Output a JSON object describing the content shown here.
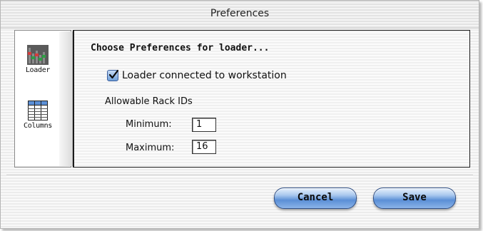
{
  "window": {
    "title": "Preferences"
  },
  "sidebar": {
    "items": [
      {
        "label": "Loader",
        "icon": "loader-icon"
      },
      {
        "label": "Columns",
        "icon": "columns-icon"
      }
    ]
  },
  "panel": {
    "heading": "Choose Preferences for loader...",
    "checkbox": {
      "label": "Loader connected to workstation",
      "checked": true
    },
    "group_label": "Allowable Rack IDs",
    "minimum": {
      "label": "Minimum:",
      "value": "1"
    },
    "maximum": {
      "label": "Maximum:",
      "value": "16"
    }
  },
  "buttons": {
    "cancel": "Cancel",
    "save": "Save"
  },
  "colors": {
    "accent": "#5b8fd6",
    "text": "#111111"
  }
}
